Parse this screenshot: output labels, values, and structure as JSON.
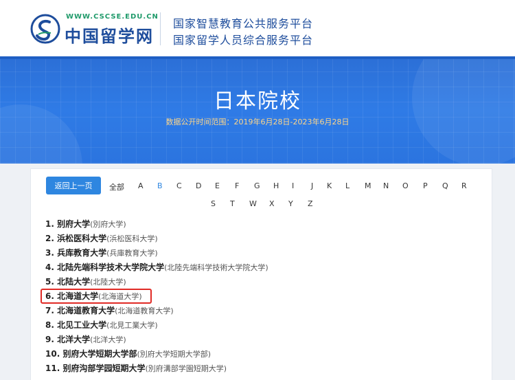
{
  "header": {
    "logo_url": "WWW.CSCSE.EDU.CN",
    "logo_name": "中国留学网",
    "platform_line1": "国家智慧教育公共服务平台",
    "platform_line2": "国家留学人员综合服务平台"
  },
  "banner": {
    "title": "日本院校",
    "subtitle": "数据公开时间范围：2019年6月28日-2023年6月28日"
  },
  "filter": {
    "back_label": "返回上一页",
    "all_label": "全部",
    "active_letter": "B",
    "letters_row1": [
      "A",
      "B",
      "C",
      "D",
      "E",
      "F",
      "G",
      "H",
      "I",
      "J",
      "K",
      "L",
      "M",
      "N",
      "O",
      "P",
      "Q",
      "R"
    ],
    "letters_row2": [
      "S",
      "T",
      "W",
      "X",
      "Y",
      "Z"
    ]
  },
  "schools": [
    {
      "num": "1.",
      "name": "别府大学",
      "orig": "(別府大学)"
    },
    {
      "num": "2.",
      "name": "浜松医科大学",
      "orig": "(浜松医科大学)"
    },
    {
      "num": "3.",
      "name": "兵库教育大学",
      "orig": "(兵庫教育大学)"
    },
    {
      "num": "4.",
      "name": "北陆先端科学技术大学院大学",
      "orig": "(北陸先端科学技術大学院大学)"
    },
    {
      "num": "5.",
      "name": "北陆大学",
      "orig": "(北陸大学)"
    },
    {
      "num": "6.",
      "name": "北海道大学",
      "orig": "(北海道大学)"
    },
    {
      "num": "7.",
      "name": "北海道教育大学",
      "orig": "(北海道教育大学)"
    },
    {
      "num": "8.",
      "name": "北见工业大学",
      "orig": "(北見工業大学)"
    },
    {
      "num": "9.",
      "name": "北洋大学",
      "orig": "(北洋大学)"
    },
    {
      "num": "10.",
      "name": "别府大学短期大学部",
      "orig": "(別府大学短期大学部)"
    },
    {
      "num": "11.",
      "name": "别府沟部学园短期大学",
      "orig": "(別府溝部学園短期大学)"
    }
  ],
  "colors": {
    "brand_blue": "#1e4d9c",
    "banner_blue": "#2f7be6",
    "accent": "#2e86e0",
    "highlight": "#e02a25",
    "subtitle": "#ffd78a"
  }
}
